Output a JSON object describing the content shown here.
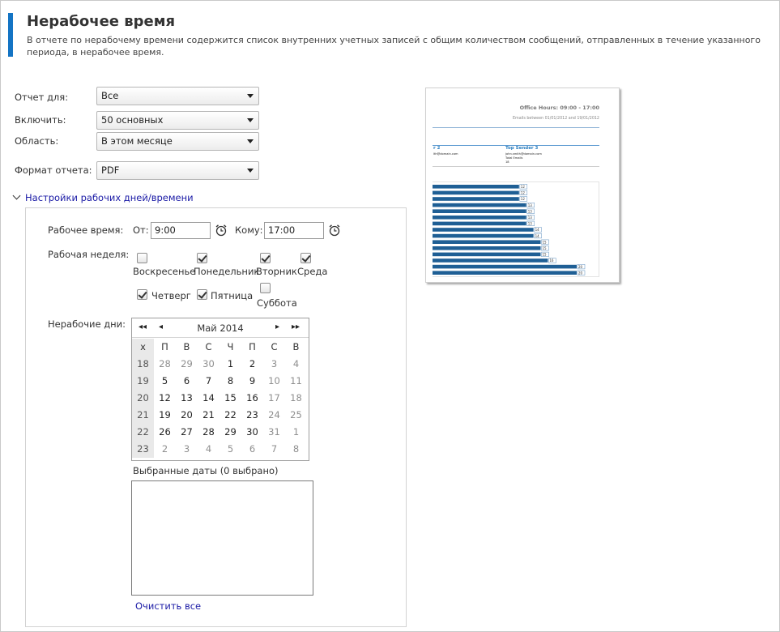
{
  "header": {
    "title": "Нерабочее время",
    "description": "В отчете по нерабочему времени содержится список внутренних учетных записей с общим количеством сообщений, отправленных в течение указанного периода, в нерабочее время."
  },
  "form": {
    "report_for_label": "Отчет для:",
    "report_for_value": "Все",
    "include_label": "Включить:",
    "include_value": "50 основных",
    "scope_label": "Область:",
    "scope_value": "В этом месяце",
    "format_label": "Формат отчета:",
    "format_value": "PDF"
  },
  "settings": {
    "toggle_label": "Настройки рабочих дней/времени",
    "work_time_label": "Рабочее время:",
    "from_label": "От:",
    "from_value": "9:00",
    "to_label": "Кому:",
    "to_value": "17:00",
    "work_week_label": "Рабочая неделя:",
    "days": [
      {
        "label": "Воскресенье",
        "checked": false
      },
      {
        "label": "Понедельник",
        "checked": true
      },
      {
        "label": "Вторник",
        "checked": true
      },
      {
        "label": "Среда",
        "checked": true
      },
      {
        "label": "Четверг",
        "checked": true
      },
      {
        "label": "Пятница",
        "checked": true
      },
      {
        "label": "Суббота",
        "checked": false
      }
    ],
    "non_work_days_label": "Нерабочие дни:",
    "selected_dates_label": "Выбранные даты (0 выбрано)",
    "clear_all_label": "Очистить все"
  },
  "calendar": {
    "month_label": "Май 2014",
    "nav": {
      "first": "◂◂",
      "prev": "◂",
      "next": "▸",
      "last": "▸▸"
    },
    "header": [
      "x",
      "П",
      "В",
      "С",
      "Ч",
      "П",
      "С",
      "В"
    ],
    "weeks": [
      {
        "wk": "18",
        "days": [
          {
            "d": "28",
            "dim": true
          },
          {
            "d": "29",
            "dim": true
          },
          {
            "d": "30",
            "dim": true
          },
          {
            "d": "1"
          },
          {
            "d": "2"
          },
          {
            "d": "3",
            "dim": true
          },
          {
            "d": "4",
            "dim": true
          }
        ]
      },
      {
        "wk": "19",
        "days": [
          {
            "d": "5"
          },
          {
            "d": "6"
          },
          {
            "d": "7"
          },
          {
            "d": "8"
          },
          {
            "d": "9"
          },
          {
            "d": "10",
            "dim": true
          },
          {
            "d": "11",
            "dim": true
          }
        ]
      },
      {
        "wk": "20",
        "days": [
          {
            "d": "12"
          },
          {
            "d": "13"
          },
          {
            "d": "14"
          },
          {
            "d": "15"
          },
          {
            "d": "16"
          },
          {
            "d": "17",
            "dim": true
          },
          {
            "d": "18",
            "dim": true
          }
        ]
      },
      {
        "wk": "21",
        "days": [
          {
            "d": "19"
          },
          {
            "d": "20"
          },
          {
            "d": "21"
          },
          {
            "d": "22"
          },
          {
            "d": "23"
          },
          {
            "d": "24",
            "dim": true
          },
          {
            "d": "25",
            "dim": true
          }
        ]
      },
      {
        "wk": "22",
        "days": [
          {
            "d": "26"
          },
          {
            "d": "27"
          },
          {
            "d": "28"
          },
          {
            "d": "29"
          },
          {
            "d": "30"
          },
          {
            "d": "31",
            "dim": true
          },
          {
            "d": "1",
            "dim": true
          }
        ]
      },
      {
        "wk": "23",
        "days": [
          {
            "d": "2",
            "dim": true
          },
          {
            "d": "3",
            "dim": true
          },
          {
            "d": "4",
            "dim": true
          },
          {
            "d": "5",
            "dim": true
          },
          {
            "d": "6",
            "dim": true
          },
          {
            "d": "7",
            "dim": true
          },
          {
            "d": "8",
            "dim": true
          }
        ]
      }
    ]
  },
  "preview": {
    "title": "Office Hours: 09:00 - 17:00",
    "subtitle": "Emails between 01/01/2012 and 19/01/2012",
    "col1_title": "r 2",
    "col1_email": "lth@domain.com",
    "col2_title": "Top Sender 3",
    "col2_email": "john.smith@domain.com",
    "col2_total_label": "Total Emails",
    "col2_total_value": "18",
    "bars": [
      12,
      12,
      12,
      13,
      13,
      13,
      13,
      14,
      14,
      15,
      15,
      15,
      16,
      20,
      20
    ],
    "bar_color": "#1f5f95"
  },
  "colors": {
    "accent": "#1474c4",
    "link": "#1a1aa6"
  }
}
